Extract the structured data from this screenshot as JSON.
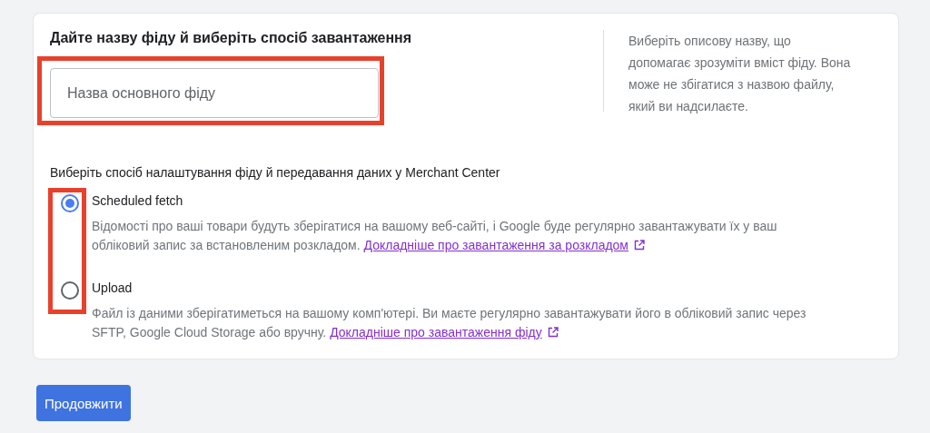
{
  "card": {
    "title": "Дайте назву фіду й виберіть спосіб завантаження",
    "name_field": {
      "placeholder": "Назва основного фіду"
    },
    "hint": "Виберіть описову назву, що допомагає зрозуміти вміст фіду. Вона може не збігатися з назвою файлу, який ви надсилаєте.",
    "method_prompt": "Виберіть спосіб налаштування фіду й передавання даних у Merchant Center",
    "options": [
      {
        "label": "Scheduled fetch",
        "selected": true,
        "description": "Відомості про ваші товари будуть зберігатися на вашому веб-сайті, і Google буде регулярно завантажувати їх у ваш обліковий запис за встановленим розкладом.",
        "link": "Докладніше про завантаження за розкладом"
      },
      {
        "label": "Upload",
        "selected": false,
        "description": "Файл із даними зберігатиметься на вашому комп'ютері. Ви маєте регулярно завантажувати його в обліковий запис через SFTP, Google Cloud Storage або вручну.",
        "link": "Докладніше про завантаження фіду"
      }
    ]
  },
  "continue_button": "Продовжити"
}
